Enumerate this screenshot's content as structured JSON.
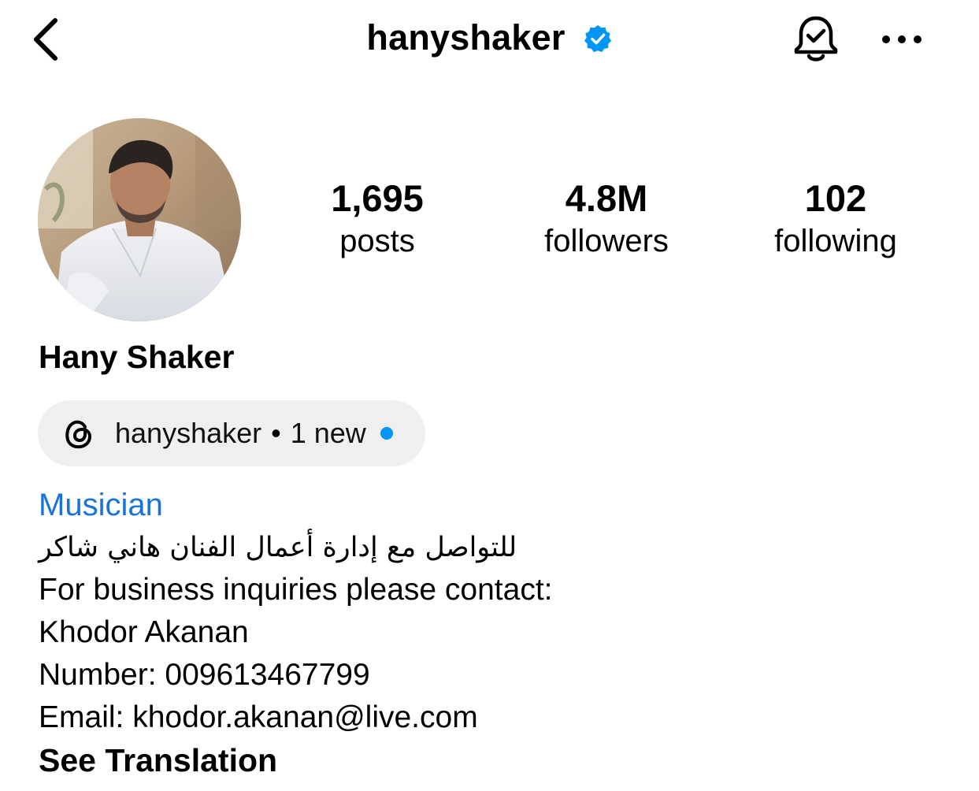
{
  "header": {
    "username": "hanyshaker",
    "verified": true,
    "icons": {
      "back": "back-chevron-icon",
      "verified": "verified-badge-icon",
      "bell": "notification-bell-icon",
      "more": "more-options-icon"
    }
  },
  "profile": {
    "avatar": "profile-photo",
    "full_name": "Hany Shaker",
    "stats": [
      {
        "value": "1,695",
        "label": "posts"
      },
      {
        "value": "4.8M",
        "label": "followers"
      },
      {
        "value": "102",
        "label": "following"
      }
    ]
  },
  "threads": {
    "icon": "threads-icon",
    "handle": "hanyshaker",
    "separator": "•",
    "badge": "1 new"
  },
  "bio": {
    "category": "Musician",
    "lines": [
      "للتواصل مع إدارة أعمال الفنان هاني شاكر",
      "For business inquiries please contact:",
      "Khodor Akanan",
      "Number: 009613467799",
      "Email: khodor.akanan@live.com"
    ],
    "see_translation": "See Translation"
  },
  "colors": {
    "link_blue": "#1a73d9",
    "verified_blue": "#0095f6",
    "pill_bg": "#efeff1"
  }
}
